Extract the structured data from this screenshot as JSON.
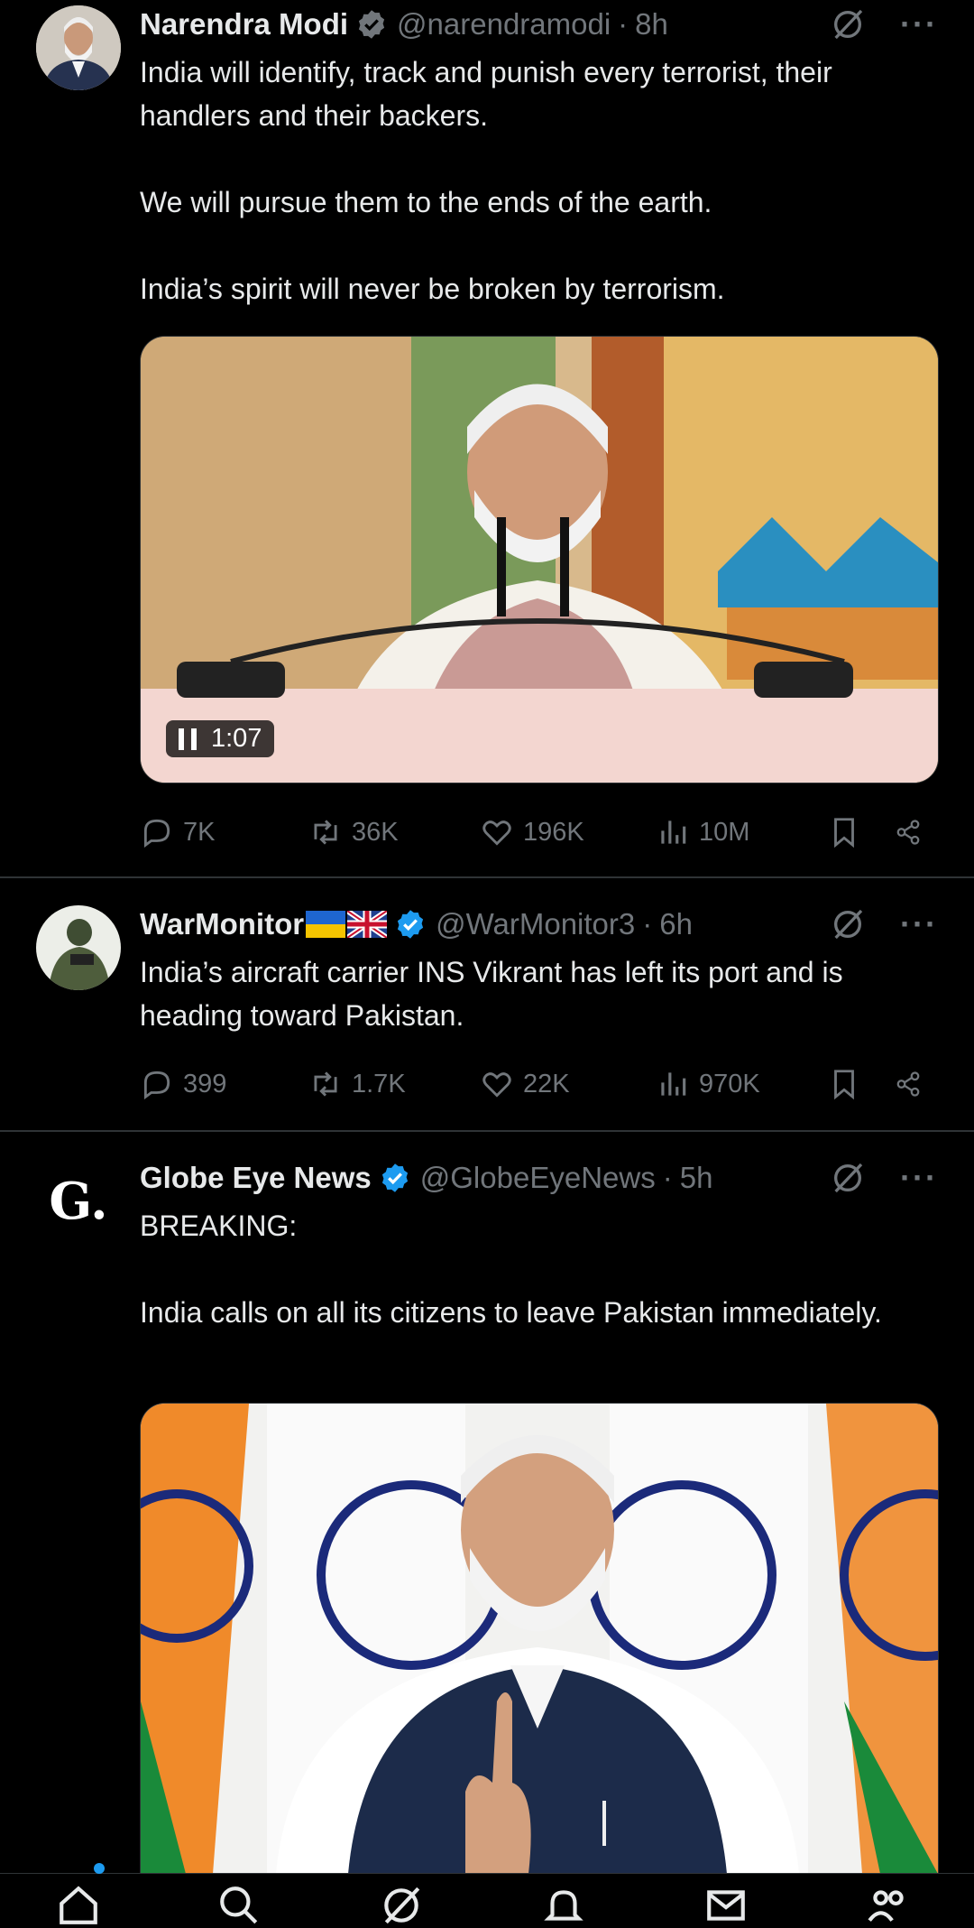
{
  "posts": [
    {
      "name": "Narendra Modi",
      "flags": "",
      "handle": "@narendramodi",
      "time": "8h",
      "text": "India will identify, track and punish every terrorist, their handlers and their backers.\n\nWe will pursue them to the ends of the earth.\n\nIndia’s spirit will never be broken by terrorism.",
      "video_time": "1:07",
      "replies": "7K",
      "reposts": "36K",
      "likes": "196K",
      "views": "10M"
    },
    {
      "name": "WarMonitor",
      "flags": "🇺🇦🇬🇧",
      "handle": "@WarMonitor3",
      "time": "6h",
      "text": "India’s aircraft carrier INS Vikrant has left its port and is heading toward Pakistan.",
      "replies": "399",
      "reposts": "1.7K",
      "likes": "22K",
      "views": "970K"
    },
    {
      "name": "Globe Eye News",
      "flags": "",
      "handle": "@GlobeEyeNews",
      "time": "5h",
      "avatar_letter": "G.",
      "text": "BREAKING:\n\nIndia calls on all its citizens to leave Pakistan immediately."
    }
  ],
  "colors": {
    "verified": "#1d9bf0",
    "muted": "#71767b",
    "text": "#e7e9ea",
    "divider": "#2f3336"
  },
  "icons": [
    "reply-icon",
    "repost-icon",
    "like-icon",
    "views-icon",
    "bookmark-icon",
    "share-icon",
    "grok-icon",
    "more-icon"
  ]
}
